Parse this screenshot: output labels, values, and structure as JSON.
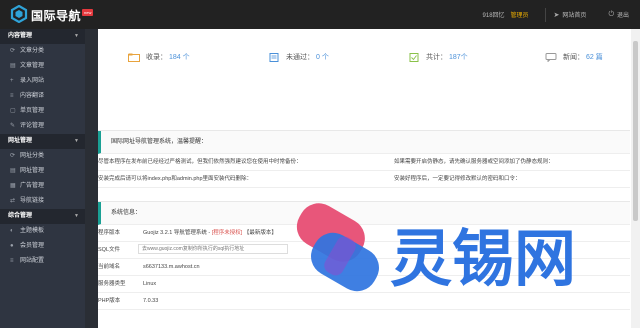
{
  "app": {
    "title": "国际导航",
    "badge": "new"
  },
  "topbar": {
    "item1": "918回忆",
    "role": "管理员",
    "site_home": "网站首页",
    "exit": "退出"
  },
  "sidebar": [
    {
      "group": "内容管理",
      "items": [
        {
          "label": "文章分类",
          "icon": "⟳"
        },
        {
          "label": "文章管理",
          "icon": "▤"
        },
        {
          "label": "录入网站",
          "icon": "+"
        },
        {
          "label": "内容翻译",
          "icon": "≡"
        },
        {
          "label": "单页管理",
          "icon": "▢"
        },
        {
          "label": "评论管理",
          "icon": "✎"
        }
      ]
    },
    {
      "group": "网址管理",
      "items": [
        {
          "label": "网址分类",
          "icon": "⟳"
        },
        {
          "label": "网址管理",
          "icon": "▤"
        },
        {
          "label": "广告管理",
          "icon": "▦"
        },
        {
          "label": "导航链接",
          "icon": "⇄"
        }
      ]
    },
    {
      "group": "综合管理",
      "items": [
        {
          "label": "主题模板",
          "icon": "◐"
        },
        {
          "label": "会员管理",
          "icon": "●"
        },
        {
          "label": "网站配置",
          "icon": "≡"
        }
      ]
    }
  ],
  "stats": [
    {
      "label": "收录",
      "value": "184 个",
      "color": "#e8a33d"
    },
    {
      "label": "未通过",
      "value": "0 个",
      "color": "#4a90d9"
    },
    {
      "label": "共计",
      "value": "187个",
      "color": "#8ac249"
    },
    {
      "label": "新闻",
      "value": "62 篇",
      "color": "#999999"
    }
  ],
  "notice": {
    "title": "国际网址导航管理系统，温馨提醒：",
    "rows": [
      [
        "尽管本程序在发布前已经经过严格测试，但我们依然强烈建议您在使用中时常备份：",
        "如果需要开启伪静态，请先确认服务器或空间添加了伪静态规则："
      ],
      [
        "安装完成后请可以将index.php和admin.php里面安装代码删除：",
        "安装好程序后，一定要记得修改默认的密码和口令："
      ]
    ]
  },
  "sysinfo": {
    "title": "系统信息：",
    "version_label": "程序版本",
    "version_value": "Guojiz 3.2.1 导航管理系统 -",
    "version_red": "[程序未授权]",
    "version_new": "【最新版本】",
    "sql_label": "SQL文件",
    "sql_placeholder": "去www.guojiz.com复制你所执行的sql执行地址",
    "domain_label": "当前域名",
    "domain_value": "s6637133.m.awhost.cn",
    "server_label": "服务器类型",
    "server_value": "Linux",
    "php_label": "PHP版本",
    "php_value": "7.0.33"
  },
  "watermark": {
    "text": "灵锡网",
    "color": "#2f74e0"
  }
}
